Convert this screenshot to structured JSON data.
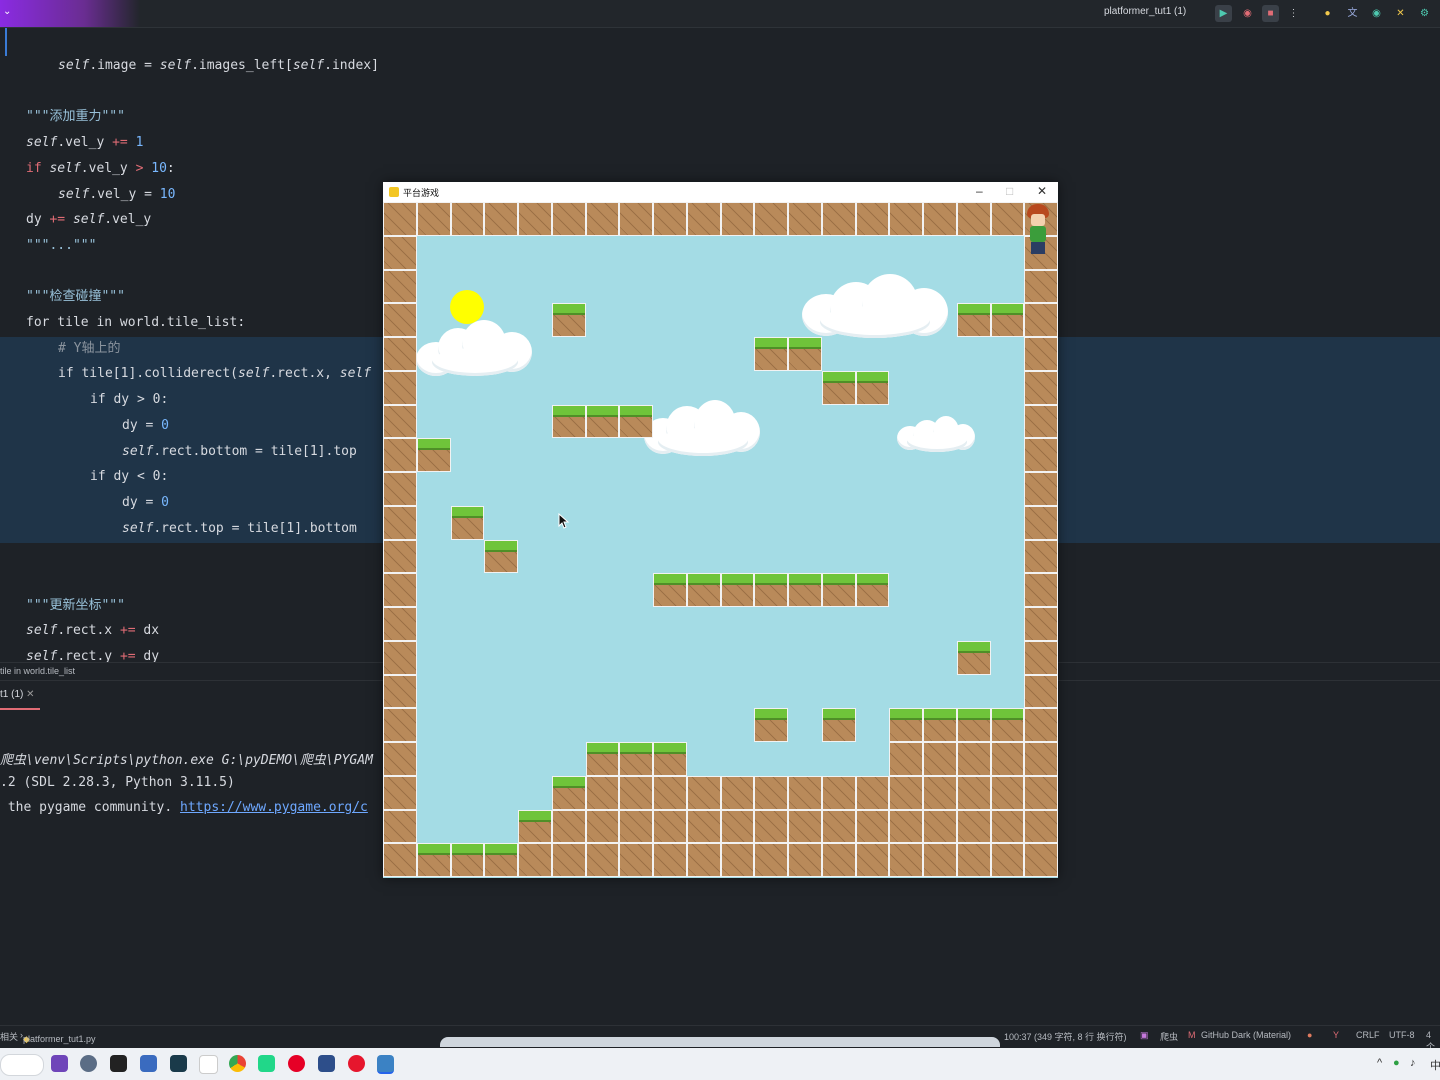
{
  "ide": {
    "run_config": "platformer_tut1 (1)",
    "editor_lines": [
      {
        "indent": 1,
        "html": "<span class='self'>self</span>.image = <span class='self'>self</span>.images_left[<span class='self'>self</span>.index]"
      },
      {
        "indent": 0,
        "html": ""
      },
      {
        "indent": 0,
        "html": "<span class='str'>\"\"\"添加重力\"\"\"</span>"
      },
      {
        "indent": 0,
        "html": "<span class='self'>self</span>.vel_y <span class='op'>+=</span> <span class='num'>1</span>"
      },
      {
        "indent": 0,
        "html": "<span class='kw'>if</span> <span class='self'>self</span>.vel_y <span class='op'>&gt;</span> <span class='num'>10</span>:"
      },
      {
        "indent": 1,
        "html": "<span class='self'>self</span>.vel_y = <span class='num'>10</span>"
      },
      {
        "indent": 0,
        "html": "dy <span class='op'>+=</span> <span class='self'>self</span>.vel_y"
      },
      {
        "indent": 0,
        "html": "<span class='str'>\"\"\"...\"\"\"</span>"
      },
      {
        "indent": 0,
        "html": ""
      },
      {
        "indent": 0,
        "html": "<span class='str'>\"\"\"检查碰撞\"\"\"</span>"
      },
      {
        "indent": 0,
        "html": "for tile in world.tile_list:"
      },
      {
        "indent": 1,
        "html": "<span class='cmt'># Y轴上的</span>"
      },
      {
        "indent": 1,
        "html": "if tile[1].colliderect(<span class='self'>self</span>.rect.x, <span class='self'>self</span>"
      },
      {
        "indent": 2,
        "html": "if dy &gt; 0:"
      },
      {
        "indent": 3,
        "html": "dy = <span class='num'>0</span>"
      },
      {
        "indent": 3,
        "html": "<span class='self'>self</span>.rect.bottom = tile[1].top"
      },
      {
        "indent": 2,
        "html": "if dy &lt; 0:"
      },
      {
        "indent": 3,
        "html": "dy = <span class='num'>0</span>"
      },
      {
        "indent": 3,
        "html": "<span class='self'>self</span>.rect.top = tile[1].bottom"
      },
      {
        "indent": 0,
        "html": ""
      },
      {
        "indent": 0,
        "html": ""
      },
      {
        "indent": 0,
        "html": "<span class='str'>\"\"\"更新坐标\"\"\"</span>"
      },
      {
        "indent": 0,
        "html": "<span class='self'>self</span>.rect.x <span class='op'>+=</span> dx"
      },
      {
        "indent": 0,
        "html": "<span class='self'>self</span>.rect.y <span class='op'>+=</span> dy"
      }
    ],
    "breadcrumb": "tile in world.tile_list",
    "run_tab": "t1 (1)",
    "console_lines": [
      {
        "text": "爬虫\\venv\\Scripts\\python.exe G:\\pyDEMO\\爬虫\\PYGAM",
        "italic": true
      },
      {
        "text": ".2 (SDL 2.28.3, Python 3.11.5)"
      },
      {
        "text": " the pygame community. ",
        "link": "https://www.pygame.org/c"
      }
    ],
    "status_left_a": "相关",
    "status_left_b": "platformer_tut1.py",
    "status_pos": "100:37 (349 字符, 8 行 换行符)",
    "status_branch": "爬虫",
    "status_theme": "GitHub Dark (Material)",
    "status_eol": "CRLF",
    "status_enc": "UTF-8",
    "status_indent": "4 个"
  },
  "game_window": {
    "title": "平台游戏",
    "minimize": "–",
    "maximize": "□",
    "close": "✕"
  },
  "world_grid": [
    "11111111111111111111",
    "10000000000000000001",
    "10000000000000000001",
    "10000200000000000221",
    "10000000000220000001",
    "10000000000002200001",
    "10000222000000000001",
    "12000000000000000001",
    "10000000000000000001",
    "10200000000000000001",
    "10020000000000000001",
    "10000000222222200001",
    "10000000000000000001",
    "10000000000000000201",
    "10000000000000000001",
    "10000000000202022221",
    "10000022200000011111",
    "10000211111111111111",
    "10002111111111111111",
    "12221111111111111111"
  ]
}
